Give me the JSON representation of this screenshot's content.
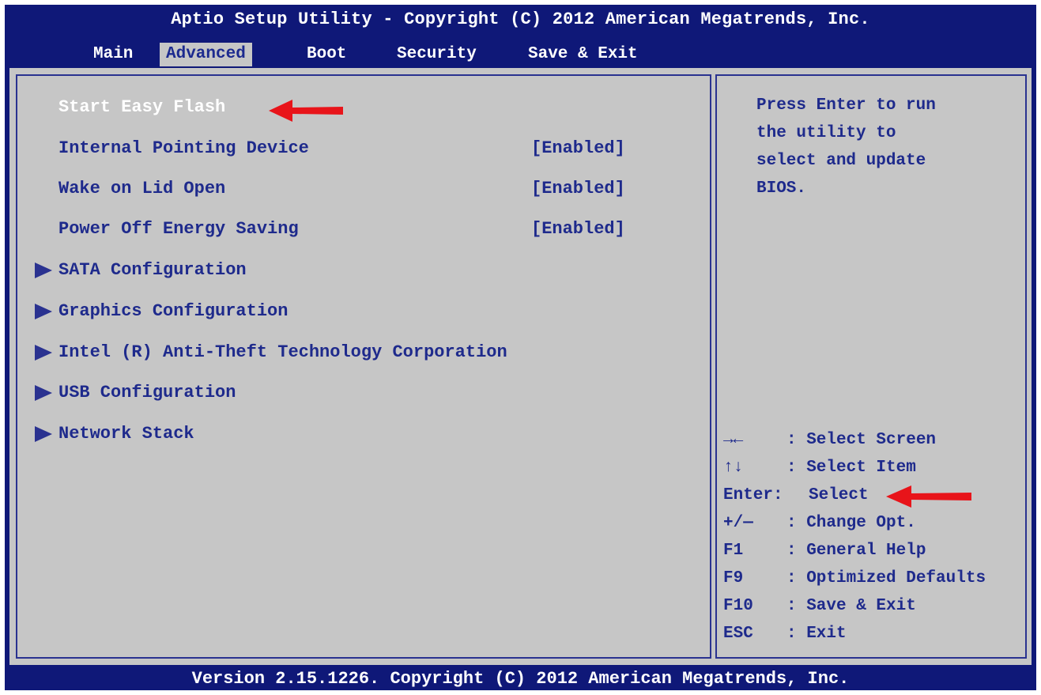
{
  "title": "Aptio Setup Utility - Copyright (C) 2012 American Megatrends, Inc.",
  "tabs": [
    "Main",
    "Advanced",
    "Boot",
    "Security",
    "Save & Exit"
  ],
  "active_tab": "Advanced",
  "items": [
    {
      "label": "Start Easy Flash",
      "value": "",
      "selected": true
    },
    {
      "label": "Internal Pointing Device",
      "value": "[Enabled]"
    },
    {
      "label": "Wake on Lid Open",
      "value": "[Enabled]"
    },
    {
      "label": "Power Off Energy Saving",
      "value": "[Enabled]"
    },
    {
      "label": "SATA Configuration",
      "submenu": true
    },
    {
      "label": "Graphics Configuration",
      "submenu": true
    },
    {
      "label": "Intel (R) Anti-Theft Technology Corporation",
      "submenu": true
    },
    {
      "label": "USB Configuration",
      "submenu": true
    },
    {
      "label": "Network Stack",
      "submenu": true
    }
  ],
  "help_lines": [
    "Press Enter to run",
    "the utility to",
    "select and update",
    "BIOS."
  ],
  "keys": [
    {
      "key": "→←",
      "desc": ": Select Screen"
    },
    {
      "key": "↑↓",
      "desc": ": Select Item"
    },
    {
      "key": "Enter:",
      "desc": "Select"
    },
    {
      "key": "+/—",
      "desc": ": Change Opt."
    },
    {
      "key": "F1",
      "desc": ": General Help"
    },
    {
      "key": "F9",
      "desc": ": Optimized Defaults"
    },
    {
      "key": "F10",
      "desc": ": Save & Exit"
    },
    {
      "key": "ESC",
      "desc": ": Exit"
    }
  ],
  "footer": "Version 2.15.1226. Copyright (C) 2012 American Megatrends, Inc.",
  "colors": {
    "background": "#0f1878",
    "panel": "#c6c6c6",
    "item_text": "#1e2a8c",
    "highlight_text": "#ffffff",
    "annotation_arrow": "#e8141a"
  },
  "icons": {
    "submenu": "submenu-arrow-icon",
    "annotation": "red-arrow-annotation-icon"
  }
}
